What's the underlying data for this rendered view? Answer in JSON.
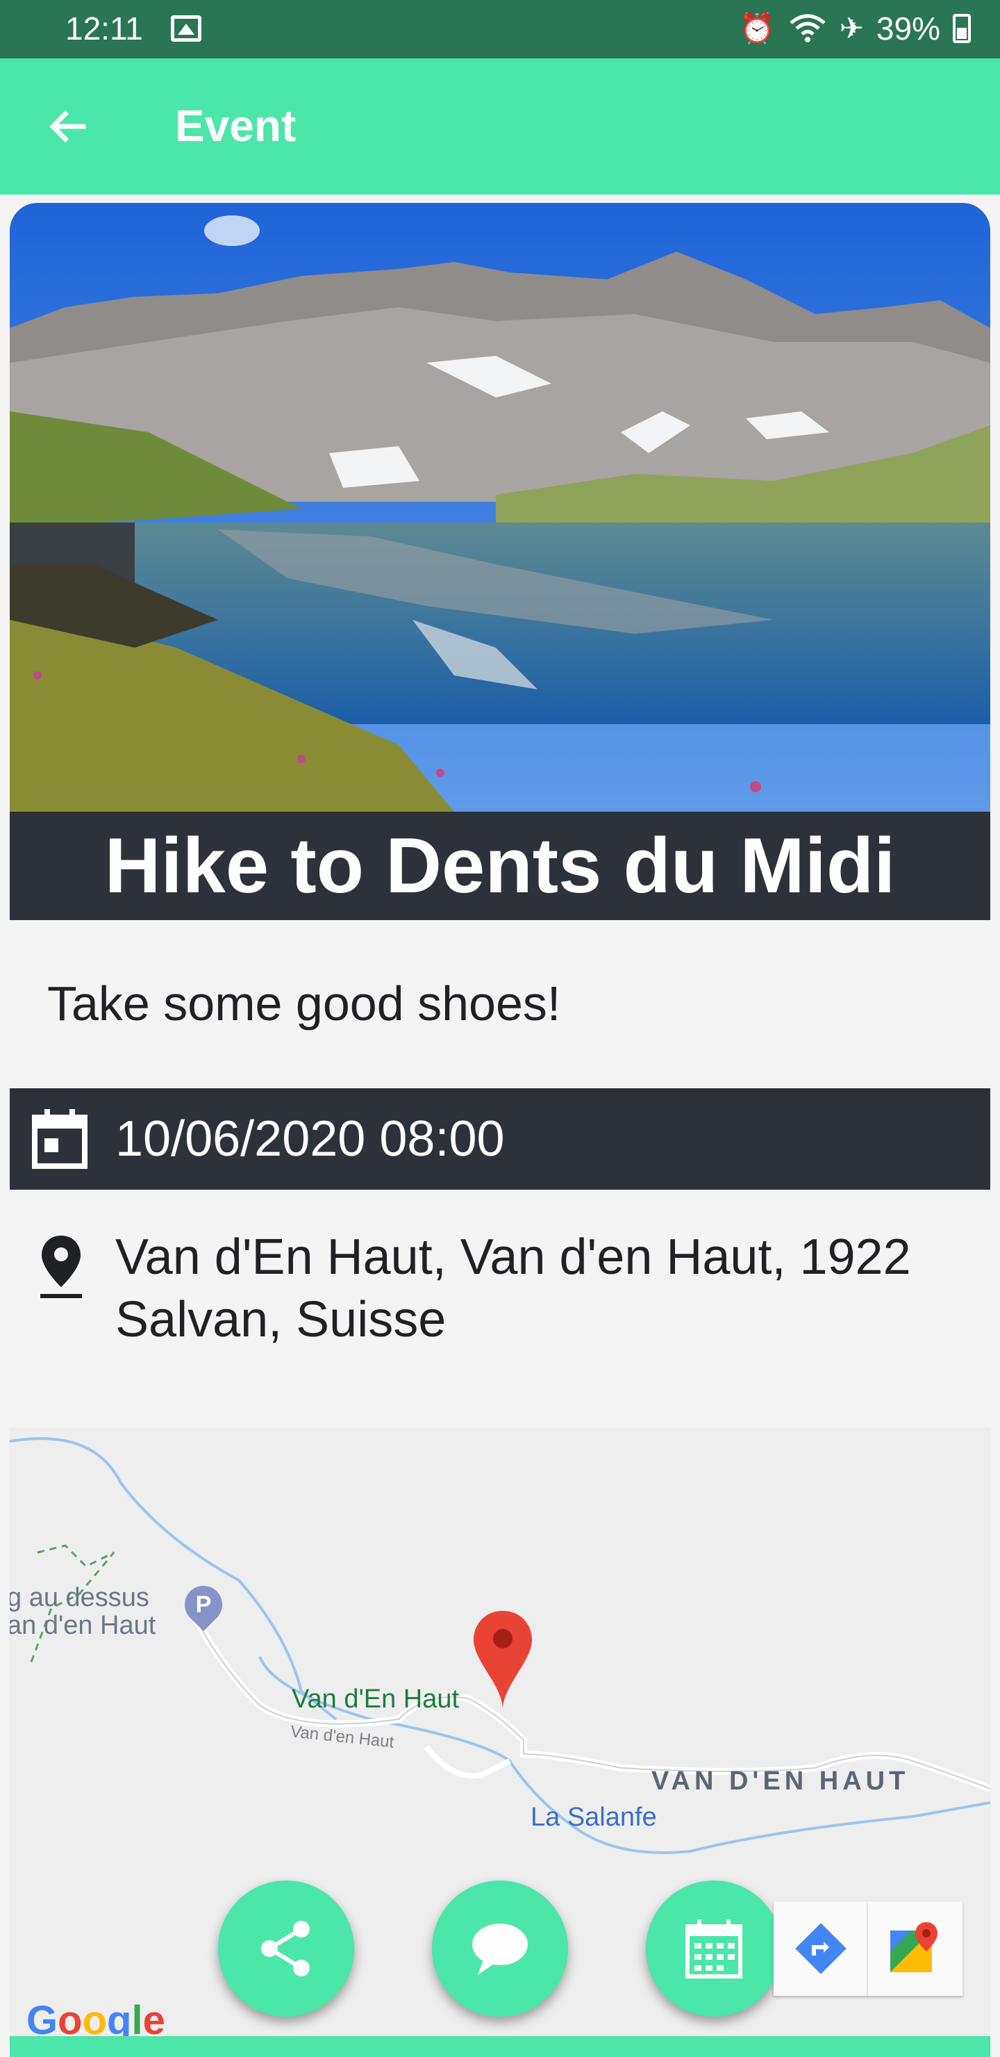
{
  "status_bar": {
    "time": "12:11",
    "battery": "39%",
    "icons": [
      "gallery-icon",
      "alarm-icon",
      "wifi-icon",
      "airplane-icon",
      "battery-icon"
    ]
  },
  "app_bar": {
    "title": "Event",
    "back_icon": "arrow-left-icon",
    "background_color": "#4be6a9"
  },
  "event": {
    "title": "Hike to Dents du Midi",
    "description": "Take some good shoes!",
    "datetime": "10/06/2020 08:00",
    "address": "Van d'En Haut, Van d'en Haut, 1922 Salvan, Suisse"
  },
  "map": {
    "labels": {
      "parking_line1": "g au dessus",
      "parking_line2": "an d'en Haut",
      "place": "Van d'En Haut",
      "road": "Van d'en Haut",
      "area": "VAN D'EN HAUT",
      "river": "La Salanfe"
    },
    "provider": "Google"
  },
  "actions": {
    "share_icon": "share-icon",
    "comment_icon": "chat-bubble-icon",
    "calendar_icon": "calendar-icon",
    "directions_icon": "directions-icon",
    "maps_icon": "google-maps-icon"
  },
  "colors": {
    "accent": "#4be6a9",
    "status_bar": "#2a7553",
    "dark_band": "#2d323a",
    "background": "#f4f4f5"
  }
}
